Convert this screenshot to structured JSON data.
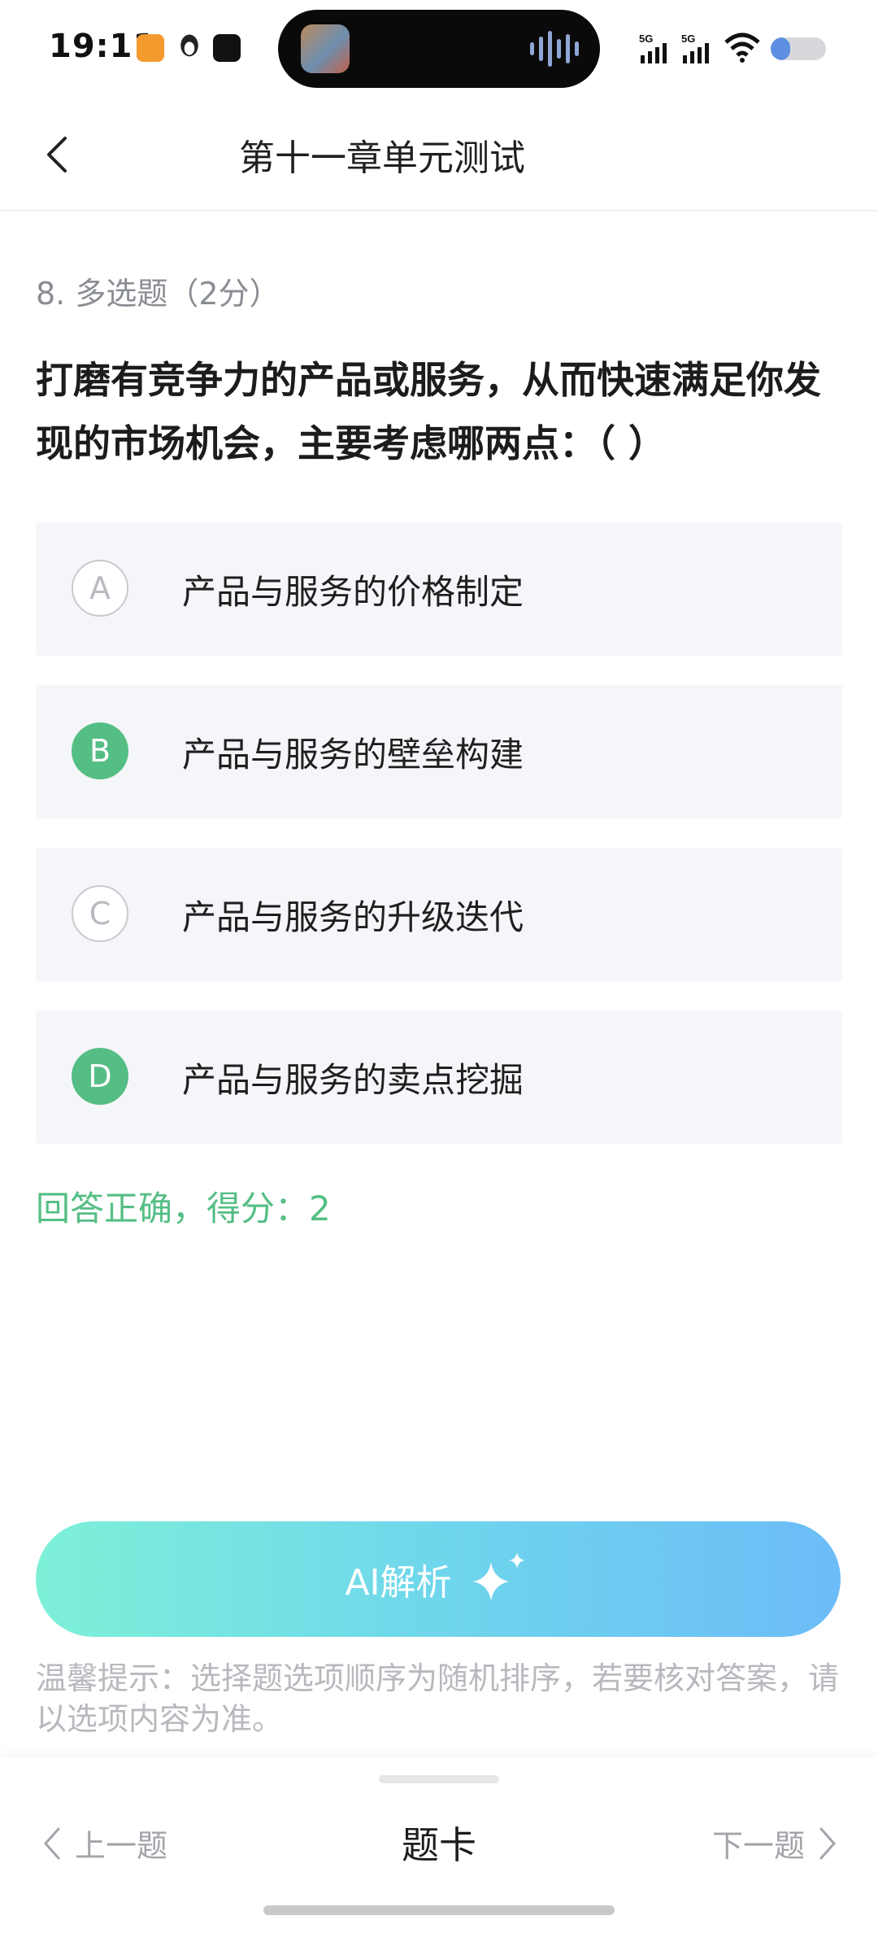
{
  "status_bar": {
    "time": "19:11",
    "network_1": "5G",
    "network_2": "5G",
    "battery_level": 0.35
  },
  "header": {
    "title": "第十一章单元测试"
  },
  "question": {
    "meta": "8. 多选题（2分）",
    "text": "打磨有竞争力的产品或服务，从而快速满足你发现的市场机会，主要考虑哪两点：（ ）"
  },
  "options": [
    {
      "letter": "A",
      "label": "产品与服务的价格制定",
      "selected": false
    },
    {
      "letter": "B",
      "label": "产品与服务的壁垒构建",
      "selected": true
    },
    {
      "letter": "C",
      "label": "产品与服务的升级迭代",
      "selected": false
    },
    {
      "letter": "D",
      "label": "产品与服务的卖点挖掘",
      "selected": true
    }
  ],
  "result": "回答正确，得分：2",
  "ai_button": {
    "label": "AI解析"
  },
  "tip": "温馨提示：选择题选项顺序为随机排序，若要核对答案，请以选项内容为准。",
  "bottom_nav": {
    "prev_label": "上一题",
    "card_label": "题卡",
    "next_label": "下一题"
  },
  "colors": {
    "accent_green": "#55be84",
    "option_bg": "#f5f6fa",
    "ai_gradient_start": "#7ef0d8",
    "ai_gradient_end": "#6cbcf7"
  }
}
